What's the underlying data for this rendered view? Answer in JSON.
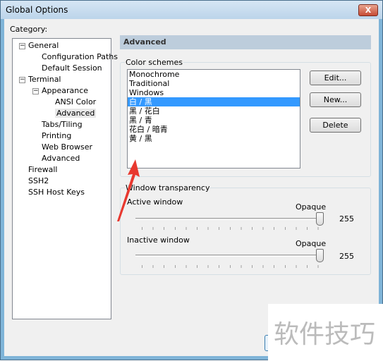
{
  "window": {
    "title": "Global Options",
    "close_label": "X"
  },
  "category_label": "Category:",
  "tree": [
    {
      "label": "General",
      "level": 0,
      "expander": "-"
    },
    {
      "label": "Configuration Paths",
      "level": 1
    },
    {
      "label": "Default Session",
      "level": 1
    },
    {
      "label": "Terminal",
      "level": 0,
      "expander": "-"
    },
    {
      "label": "Appearance",
      "level": 1,
      "expander": "-"
    },
    {
      "label": "ANSI Color",
      "level": 2
    },
    {
      "label": "Advanced",
      "level": 2,
      "selected": true
    },
    {
      "label": "Tabs/Tiling",
      "level": 1
    },
    {
      "label": "Printing",
      "level": 1
    },
    {
      "label": "Web Browser",
      "level": 1
    },
    {
      "label": "Advanced",
      "level": 1
    },
    {
      "label": "Firewall",
      "level": 0
    },
    {
      "label": "SSH2",
      "level": 0
    },
    {
      "label": "SSH Host Keys",
      "level": 0
    }
  ],
  "panel": {
    "title": "Advanced",
    "color_schemes": {
      "label": "Color schemes",
      "items": [
        "Monochrome",
        "Traditional",
        "Windows",
        "白 / 黑",
        "黑 / 花白",
        "黑 / 青",
        "花白 / 暗青",
        "黄 / 黑"
      ],
      "selected": "白 / 黑",
      "buttons": {
        "edit": "Edit...",
        "new": "New...",
        "delete": "Delete"
      }
    },
    "transparency": {
      "label": "Window transparency",
      "active": {
        "label": "Active window",
        "end_label": "Opaque",
        "value": "255",
        "fraction": 1.0
      },
      "inactive": {
        "label": "Inactive window",
        "end_label": "Opaque",
        "value": "255",
        "fraction": 1.0
      }
    }
  },
  "watermark": "软件技巧",
  "colors": {
    "selection": "#3399ff",
    "header": "#bdcddc",
    "arrow": "#e8382f"
  }
}
